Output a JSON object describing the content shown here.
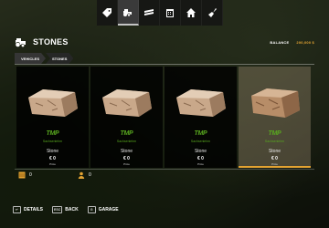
{
  "nav": {
    "tabs": [
      {
        "icon": "price-tag-icon",
        "active": false
      },
      {
        "icon": "tractor-icon",
        "active": true
      },
      {
        "icon": "wood-logs-icon",
        "active": false
      },
      {
        "icon": "calendar-icon",
        "active": false
      },
      {
        "icon": "house-icon",
        "active": false
      },
      {
        "icon": "shovel-icon",
        "active": false
      }
    ]
  },
  "header": {
    "title": "STONES",
    "balance_label": "BALANCE",
    "balance_value": "200,000 $"
  },
  "breadcrumb": {
    "items": [
      "VEHICLES",
      "STONES"
    ]
  },
  "cards": [
    {
      "brand": "TMP",
      "brand_sub": "Sachsenlehm",
      "name": "Stone",
      "price": "€ 0",
      "price_label": "Price",
      "selected": false
    },
    {
      "brand": "TMP",
      "brand_sub": "Sachsenlehm",
      "name": "Stone",
      "price": "€ 0",
      "price_label": "Price",
      "selected": false
    },
    {
      "brand": "TMP",
      "brand_sub": "Sachsenlehm",
      "name": "Stone",
      "price": "€ 0",
      "price_label": "Price",
      "selected": false
    },
    {
      "brand": "TMP",
      "brand_sub": "Sachsenlehm",
      "name": "Stone",
      "price": "€ 0",
      "price_label": "Price",
      "selected": true
    }
  ],
  "stats": {
    "capacity": "0",
    "workers": "0"
  },
  "actions": [
    {
      "key": "↵",
      "label": "DETAILS"
    },
    {
      "key": "ESC",
      "label": "BACK"
    },
    {
      "key": "G",
      "label": "GARAGE"
    }
  ],
  "colors": {
    "accent": "#e3a332",
    "brand_green": "#58a71f"
  }
}
